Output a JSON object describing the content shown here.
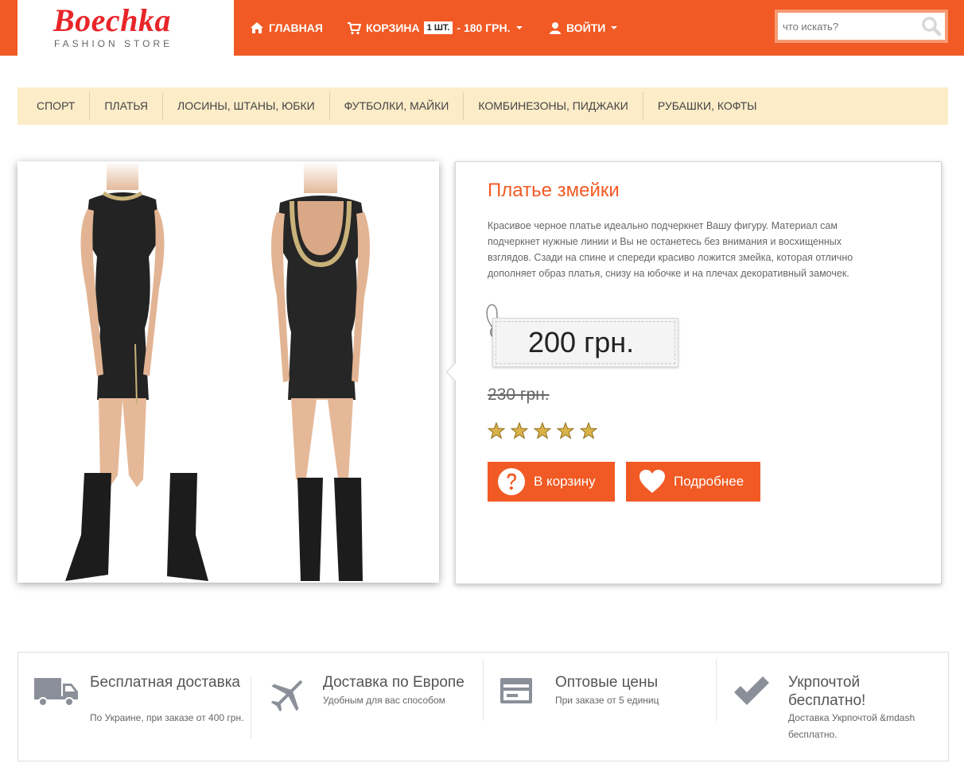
{
  "brand": {
    "name": "Boechka",
    "tagline": "FASHION STORE",
    "logo_color": "#e8262a"
  },
  "colors": {
    "accent": "#f15a24",
    "category_bar": "#fcecc8"
  },
  "nav": {
    "home": {
      "label": "ГЛАВНАЯ",
      "icon": "home-icon"
    },
    "cart": {
      "label": "КОРЗИНА",
      "count": "1 ШТ.",
      "total": "- 180 ГРН.",
      "icon": "cart-icon"
    },
    "login": {
      "label": "ВОЙТИ",
      "icon": "user-icon"
    }
  },
  "search": {
    "placeholder": "что искать?",
    "icon": "search-icon"
  },
  "categories": [
    "СПОРТ",
    "ПЛАТЬЯ",
    "ЛОСИНЫ, ШТАНЫ, ЮБКИ",
    "ФУТБОЛКИ, МАЙКИ",
    "КОМБИНЕЗОНЫ, ПИДЖАКИ",
    "РУБАШКИ, КОФТЫ"
  ],
  "product": {
    "title": "Платье змейки",
    "description": "Красивое черное платье идеально подчеркнет Вашу фигуру. Материал сам подчеркнет нужные линии и Вы не останетесь без внимания и восхищенных взглядов. Сзади на спине и спереди красиво ложится змейка, которая отлично дополняет образ платья, снизу на юбочке и на плечах декоративный замочек.",
    "price": "200 грн.",
    "old_price": "230 грн.",
    "rating": 5,
    "buttons": {
      "add_to_cart": {
        "label": "В корзину",
        "icon": "question-circle-icon"
      },
      "details": {
        "label": "Подробнее",
        "icon": "heart-icon"
      }
    }
  },
  "features": [
    {
      "icon": "truck-icon",
      "title": "Бесплатная доставка",
      "subtitle": "По Украине, при заказе от 400 грн."
    },
    {
      "icon": "airplane-icon",
      "title": "Доставка по Европе",
      "subtitle": "Удобным для вас способом"
    },
    {
      "icon": "credit-card-icon",
      "title": "Оптовые цены",
      "subtitle": "При заказе от 5 единиц"
    },
    {
      "icon": "checkmark-icon",
      "title": "Укрпочтой бесплатно!",
      "subtitle": "Доставка Укрпочтой &mdash бесплатно."
    }
  ]
}
